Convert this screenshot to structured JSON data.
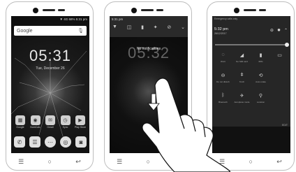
{
  "phone1": {
    "status_text": "▼ 4G 68% 5:31 pm",
    "search_label": "Google",
    "clock": "05:31",
    "date": "Tue, December 26",
    "apps": [
      {
        "icon": "grid-icon",
        "glyph": "▦",
        "label": "Google"
      },
      {
        "icon": "camera-icon",
        "glyph": "◉",
        "label": "NumCalc"
      },
      {
        "icon": "mail-icon",
        "glyph": "✉",
        "label": "Gmail"
      },
      {
        "icon": "sync-icon",
        "glyph": "◷",
        "label": "Sync"
      },
      {
        "icon": "store-icon",
        "glyph": "▶",
        "label": "Play Store"
      }
    ],
    "dock": [
      {
        "icon": "phone-icon",
        "glyph": "✆"
      },
      {
        "icon": "messages-icon",
        "glyph": "☰"
      },
      {
        "icon": "apps-icon",
        "glyph": "⋯"
      },
      {
        "icon": "chrome-icon",
        "glyph": "◎"
      },
      {
        "icon": "camera-icon",
        "glyph": "◙"
      }
    ]
  },
  "phone2": {
    "time": "5:31 pm",
    "quick_icons": [
      "▼",
      "◫",
      "▮",
      "✦",
      "⊘",
      "⌄"
    ],
    "notification_text": "No notifications",
    "clock": "05:32"
  },
  "phone3": {
    "emergency_text": "Emergency calls only",
    "time": "5:32 pm",
    "date": "26/12/2017",
    "tiles": [
      {
        "icon": "wifi-icon",
        "glyph": "◌",
        "label": "Wi-Fi"
      },
      {
        "icon": "signal-icon",
        "glyph": "◢",
        "label": "No SIM card"
      },
      {
        "icon": "battery-icon",
        "glyph": "▮",
        "label": "68%"
      },
      {
        "icon": "cast-icon",
        "glyph": "▭",
        "label": ""
      },
      {
        "icon": "dnd-icon",
        "glyph": "⊖",
        "label": "Do not disturb"
      },
      {
        "icon": "torch-icon",
        "glyph": "ǂ",
        "label": "Torch"
      },
      {
        "icon": "rotate-icon",
        "glyph": "⟲",
        "label": "Auto-rotate"
      },
      {
        "icon": "blank-icon",
        "glyph": "",
        "label": ""
      },
      {
        "icon": "bluetooth-icon",
        "glyph": "ᛒ",
        "label": "Bluetooth"
      },
      {
        "icon": "airplane-icon",
        "glyph": "✈",
        "label": "Aeroplane mode"
      },
      {
        "icon": "location-icon",
        "glyph": "⚲",
        "label": "Location"
      },
      {
        "icon": "blank2-icon",
        "glyph": "",
        "label": ""
      }
    ],
    "edit_label": "EDIT"
  }
}
